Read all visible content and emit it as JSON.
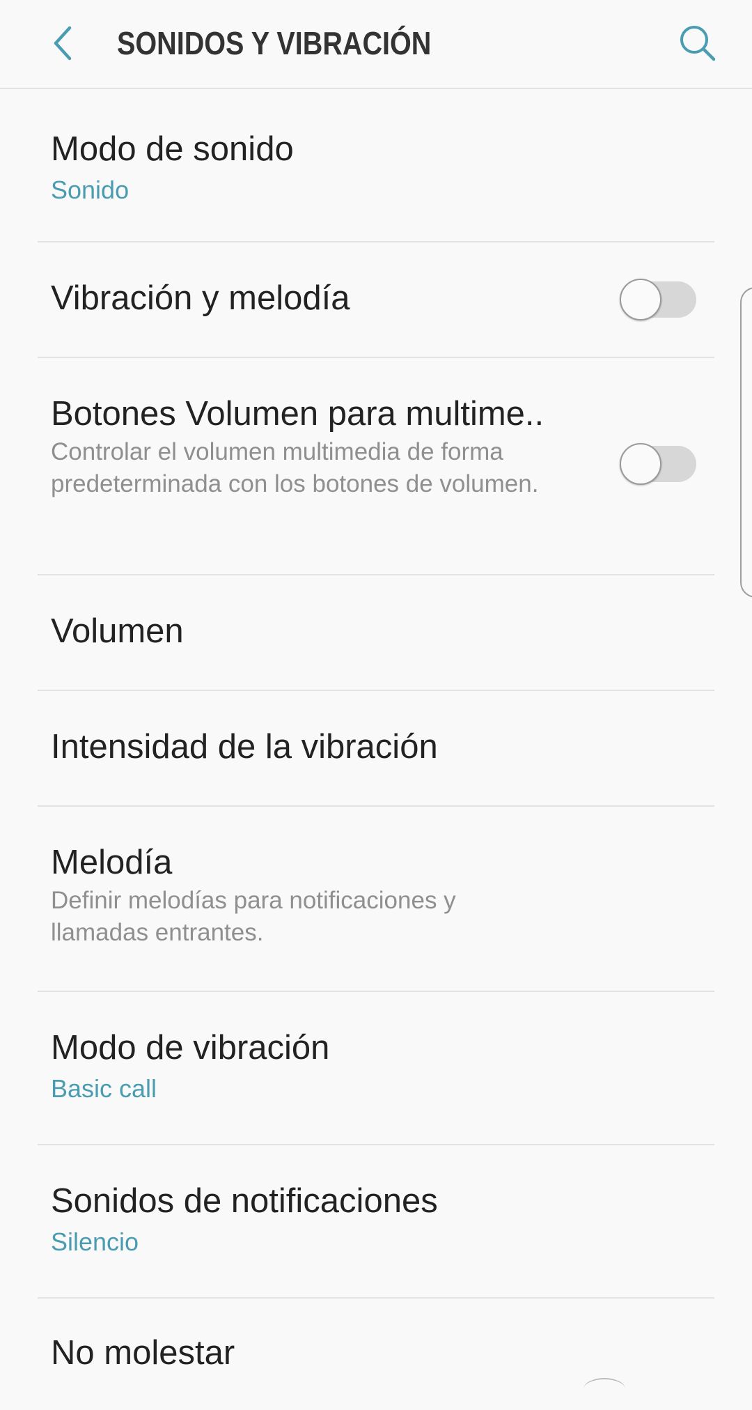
{
  "header": {
    "title": "SONIDOS Y VIBRACIÓN",
    "back_icon": "chevron-left-icon",
    "search_icon": "search-icon",
    "accent_color": "#4a9db0"
  },
  "settings": {
    "sound_mode": {
      "label": "Modo de sonido",
      "value": "Sonido"
    },
    "vibrate_while_ringing": {
      "label": "Vibración y melodía",
      "enabled": false
    },
    "volume_keys_media": {
      "label": "Botones Volumen para multime..",
      "description": "Controlar el volumen multimedia de forma predeterminada con los botones de volumen.",
      "enabled": false
    },
    "volume": {
      "label": "Volumen"
    },
    "vibration_intensity": {
      "label": "Intensidad de la vibración"
    },
    "ringtone": {
      "label": "Melodía",
      "description": "Definir melodías para notificaciones y llamadas entrantes."
    },
    "vibration_pattern": {
      "label": "Modo de vibración",
      "value": "Basic call"
    },
    "notification_sounds": {
      "label": "Sonidos de notificaciones",
      "value": "Silencio"
    },
    "do_not_disturb": {
      "label": "No molestar"
    }
  }
}
